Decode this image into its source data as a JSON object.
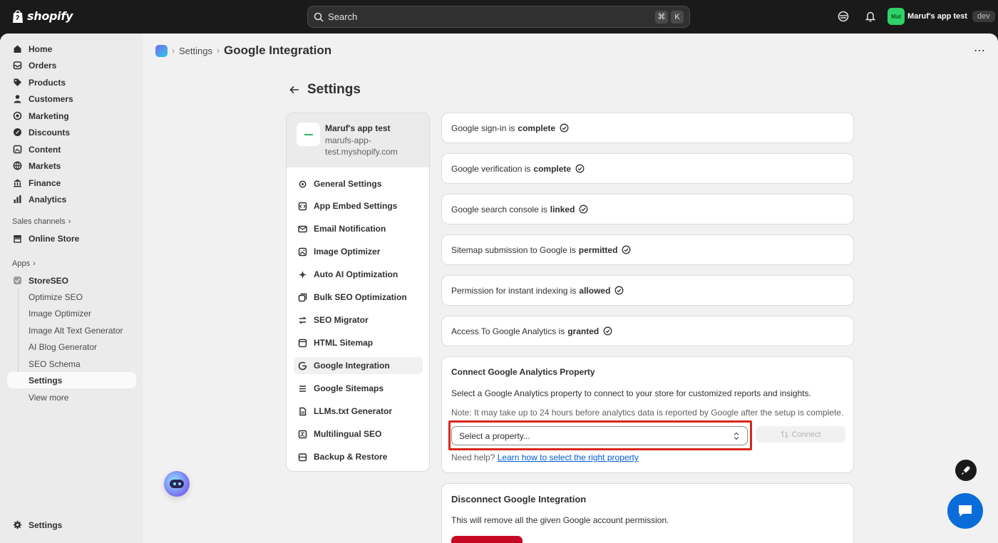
{
  "topbar": {
    "logo_text": "shopify",
    "search_placeholder": "Search",
    "kbd_cmd": "⌘",
    "kbd_k": "K",
    "store_name": "Maruf's app test",
    "store_avatar": "Mat",
    "dev_badge": "dev"
  },
  "sidebar": {
    "items": [
      {
        "label": "Home",
        "icon": "home-icon"
      },
      {
        "label": "Orders",
        "icon": "orders-icon"
      },
      {
        "label": "Products",
        "icon": "tag-icon"
      },
      {
        "label": "Customers",
        "icon": "person-icon"
      },
      {
        "label": "Marketing",
        "icon": "target-icon"
      },
      {
        "label": "Discounts",
        "icon": "discount-icon"
      },
      {
        "label": "Content",
        "icon": "content-icon"
      },
      {
        "label": "Markets",
        "icon": "globe-icon"
      },
      {
        "label": "Finance",
        "icon": "bank-icon"
      },
      {
        "label": "Analytics",
        "icon": "chart-icon"
      }
    ],
    "sales_channels_label": "Sales channels",
    "online_store_label": "Online Store",
    "apps_label": "Apps",
    "storeseo_label": "StoreSEO",
    "sub_items": [
      "Optimize SEO",
      "Image Optimizer",
      "Image Alt Text Generator",
      "AI Blog Generator",
      "SEO Schema",
      "Settings",
      "View more"
    ],
    "settings_label": "Settings"
  },
  "breadcrumb": {
    "link": "Settings",
    "current": "Google Integration"
  },
  "page": {
    "title": "Settings"
  },
  "settings_card": {
    "store_name": "Maruf's app test",
    "store_domain": "marufs-app-test.myshopify.com",
    "menu": [
      {
        "label": "General Settings",
        "icon": "gear-icon"
      },
      {
        "label": "App Embed Settings",
        "icon": "embed-icon"
      },
      {
        "label": "Email Notification",
        "icon": "email-icon"
      },
      {
        "label": "Image Optimizer",
        "icon": "image-icon"
      },
      {
        "label": "Auto AI Optimization",
        "icon": "sparkle-icon"
      },
      {
        "label": "Bulk SEO Optimization",
        "icon": "layers-icon"
      },
      {
        "label": "SEO Migrator",
        "icon": "migrate-icon"
      },
      {
        "label": "HTML Sitemap",
        "icon": "sitemap-icon"
      },
      {
        "label": "Google Integration",
        "icon": "google-icon"
      },
      {
        "label": "Google Sitemaps",
        "icon": "list-icon"
      },
      {
        "label": "LLMs.txt Generator",
        "icon": "file-icon"
      },
      {
        "label": "Multilingual SEO",
        "icon": "translate-icon"
      },
      {
        "label": "Backup & Restore",
        "icon": "backup-icon"
      }
    ]
  },
  "status": [
    {
      "text": "Google sign-in is",
      "state": "complete"
    },
    {
      "text": "Google verification is",
      "state": "complete"
    },
    {
      "text": "Google search console is",
      "state": "linked"
    },
    {
      "text": "Sitemap submission to Google is",
      "state": "permitted"
    },
    {
      "text": "Permission for instant indexing is",
      "state": "allowed"
    },
    {
      "text": "Access To Google Analytics is",
      "state": "granted"
    }
  ],
  "connect_card": {
    "title": "Connect Google Analytics Property",
    "description": "Select a Google Analytics property to connect to your store for customized reports and insights.",
    "note": "Note: It may take up to 24 hours before analytics data is reported by Google after the setup is complete.",
    "select_value": "Select a property...",
    "connect_label": "Connect",
    "help_prefix": "Need help?",
    "help_link": "Learn how to select the right property"
  },
  "disconnect_card": {
    "title": "Disconnect Google Integration",
    "description": "This will remove all the given Google account permission."
  },
  "colors": {
    "accent_link": "#005bd3",
    "highlight": "#d9261c",
    "danger": "#c70a24",
    "chat": "#0a6cd8"
  }
}
